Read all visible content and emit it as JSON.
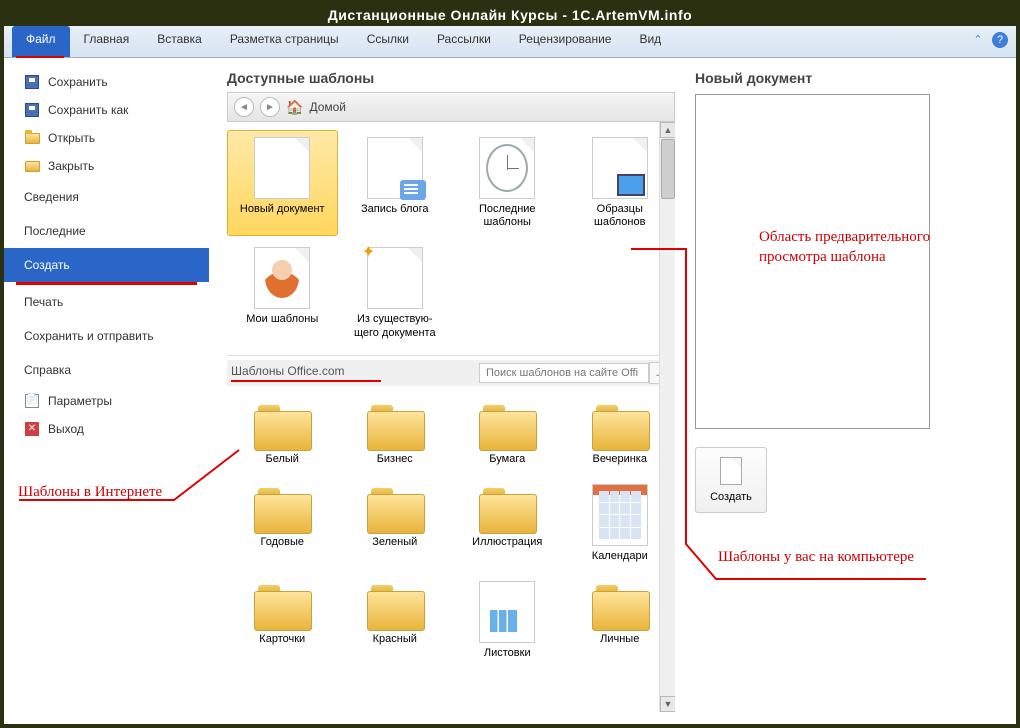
{
  "window": {
    "title": "Дистанционные Онлайн Курсы - 1C.ArtemVM.info"
  },
  "ribbon": {
    "tabs": [
      "Файл",
      "Главная",
      "Вставка",
      "Разметка страницы",
      "Ссылки",
      "Рассылки",
      "Рецензирование",
      "Вид"
    ],
    "active": "Файл"
  },
  "sidebar": {
    "items": [
      {
        "label": "Сохранить",
        "icon": "save"
      },
      {
        "label": "Сохранить как",
        "icon": "save"
      },
      {
        "label": "Открыть",
        "icon": "folder-open"
      },
      {
        "label": "Закрыть",
        "icon": "folder"
      },
      {
        "label": "Сведения",
        "spaced": true
      },
      {
        "label": "Последние",
        "spaced": true
      },
      {
        "label": "Создать",
        "selected": true,
        "spaced": true
      },
      {
        "label": "Печать",
        "spaced": true
      },
      {
        "label": "Сохранить и отправить",
        "spaced": true
      },
      {
        "label": "Справка",
        "spaced": true
      },
      {
        "label": "Параметры",
        "icon": "param"
      },
      {
        "label": "Выход",
        "icon": "exit"
      }
    ]
  },
  "templates": {
    "section_title": "Доступные шаблоны",
    "breadcrumb": "Домой",
    "local": [
      {
        "label": "Новый документ",
        "kind": "page",
        "selected": true
      },
      {
        "label": "Запись блога",
        "kind": "blog"
      },
      {
        "label": "Последние шаблоны",
        "kind": "clock"
      },
      {
        "label": "Образцы шаблонов",
        "kind": "monitor"
      },
      {
        "label": "Мои шаблоны",
        "kind": "person"
      },
      {
        "label": "Из существую-\nщего документа",
        "kind": "spark"
      }
    ],
    "office_title": "Шаблоны Office.com",
    "search_placeholder": "Поиск шаблонов на сайте Offi",
    "office": [
      {
        "label": "Белый"
      },
      {
        "label": "Бизнес"
      },
      {
        "label": "Бумага"
      },
      {
        "label": "Вечеринка"
      },
      {
        "label": "Годовые"
      },
      {
        "label": "Зеленый"
      },
      {
        "label": "Иллюстрация"
      },
      {
        "label": "Календари",
        "kind": "calendar"
      },
      {
        "label": "Карточки"
      },
      {
        "label": "Красный"
      },
      {
        "label": "Листовки",
        "kind": "flyer"
      },
      {
        "label": "Личные"
      }
    ]
  },
  "preview": {
    "title": "Новый документ",
    "create_label": "Создать"
  },
  "annotations": {
    "internet": "Шаблоны в Интернете",
    "computer": "Шаблоны у вас на компьютере",
    "preview": "Область предварительного просмотра шаблона"
  }
}
